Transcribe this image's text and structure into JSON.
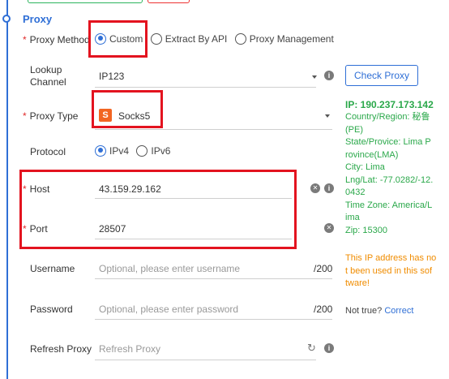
{
  "section": {
    "title": "Proxy"
  },
  "proxy_method": {
    "label": "Proxy Method",
    "options": [
      {
        "label": "Custom",
        "selected": true
      },
      {
        "label": "Extract By API",
        "selected": false
      },
      {
        "label": "Proxy Management",
        "selected": false
      }
    ]
  },
  "lookup_channel": {
    "label_line1": "Lookup",
    "label_line2": "Channel",
    "value": "IP123"
  },
  "check_proxy": {
    "label": "Check Proxy"
  },
  "proxy_type": {
    "label": "Proxy Type",
    "badge": "S",
    "value": "Socks5"
  },
  "protocol": {
    "label": "Protocol",
    "options": [
      {
        "label": "IPv4",
        "selected": true
      },
      {
        "label": "IPv6",
        "selected": false
      }
    ]
  },
  "host": {
    "label": "Host",
    "value": "43.159.29.162"
  },
  "port": {
    "label": "Port",
    "value": "28507"
  },
  "username": {
    "label": "Username",
    "placeholder": "Optional, please enter username",
    "counter": "/200"
  },
  "password": {
    "label": "Password",
    "placeholder": "Optional, please enter password",
    "counter": "/200"
  },
  "refresh_proxy": {
    "label": "Refresh Proxy",
    "placeholder": "Refresh Proxy"
  },
  "ip_info": {
    "ip": "IP:  190.237.173.142",
    "lines": [
      "Country/Region: 秘鲁",
      "(PE)",
      "State/Provice: Lima P",
      "rovince(LMA)",
      "City: Lima",
      "Lng/Lat: -77.0282/-12.",
      "0432",
      "Time Zone: America/L",
      "ima",
      "Zip: 15300"
    ],
    "warning": [
      "This IP address has no",
      "t been used in this sof",
      "tware!"
    ],
    "not_true": "Not true?",
    "correct": "Correct"
  },
  "colors": {
    "accent": "#2f6fd6",
    "required": "#e02a2a",
    "success": "#2aa84a",
    "warning": "#f08c00",
    "highlight": "#e3131f"
  }
}
